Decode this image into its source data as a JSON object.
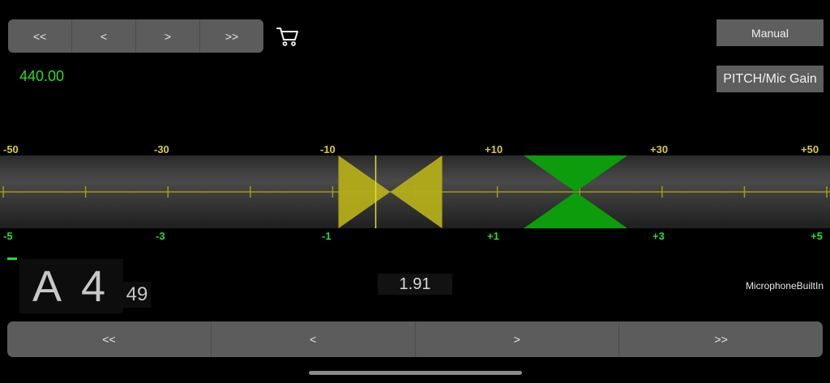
{
  "nav_top": {
    "first": "<<",
    "prev": "<",
    "next": ">",
    "last": ">>"
  },
  "buttons": {
    "manual": "Manual",
    "pitch_mic_gain": "PITCH/Mic Gain"
  },
  "reference_frequency": "440.00",
  "meter": {
    "scale_top": [
      "-50",
      "-30",
      "-10",
      "+10",
      "+30",
      "+50"
    ],
    "scale_bottom": [
      "-5",
      "-3",
      "-1",
      "+1",
      "+3",
      "+5"
    ],
    "yellow_indicator_cents": -3,
    "green_indicator_cents": 19.5,
    "colors": {
      "yellow": "#b4ad1a",
      "green": "#0c9c0c",
      "line": "#a39a16"
    }
  },
  "note": {
    "name": "A 4",
    "number": "49"
  },
  "cents_value": "1.91",
  "input_device": "MicrophoneBuiltIn",
  "nav_bottom": {
    "first": "<<",
    "prev": "<",
    "next": ">",
    "last": ">>"
  },
  "icons": {
    "cart": "shopping-cart-icon"
  }
}
